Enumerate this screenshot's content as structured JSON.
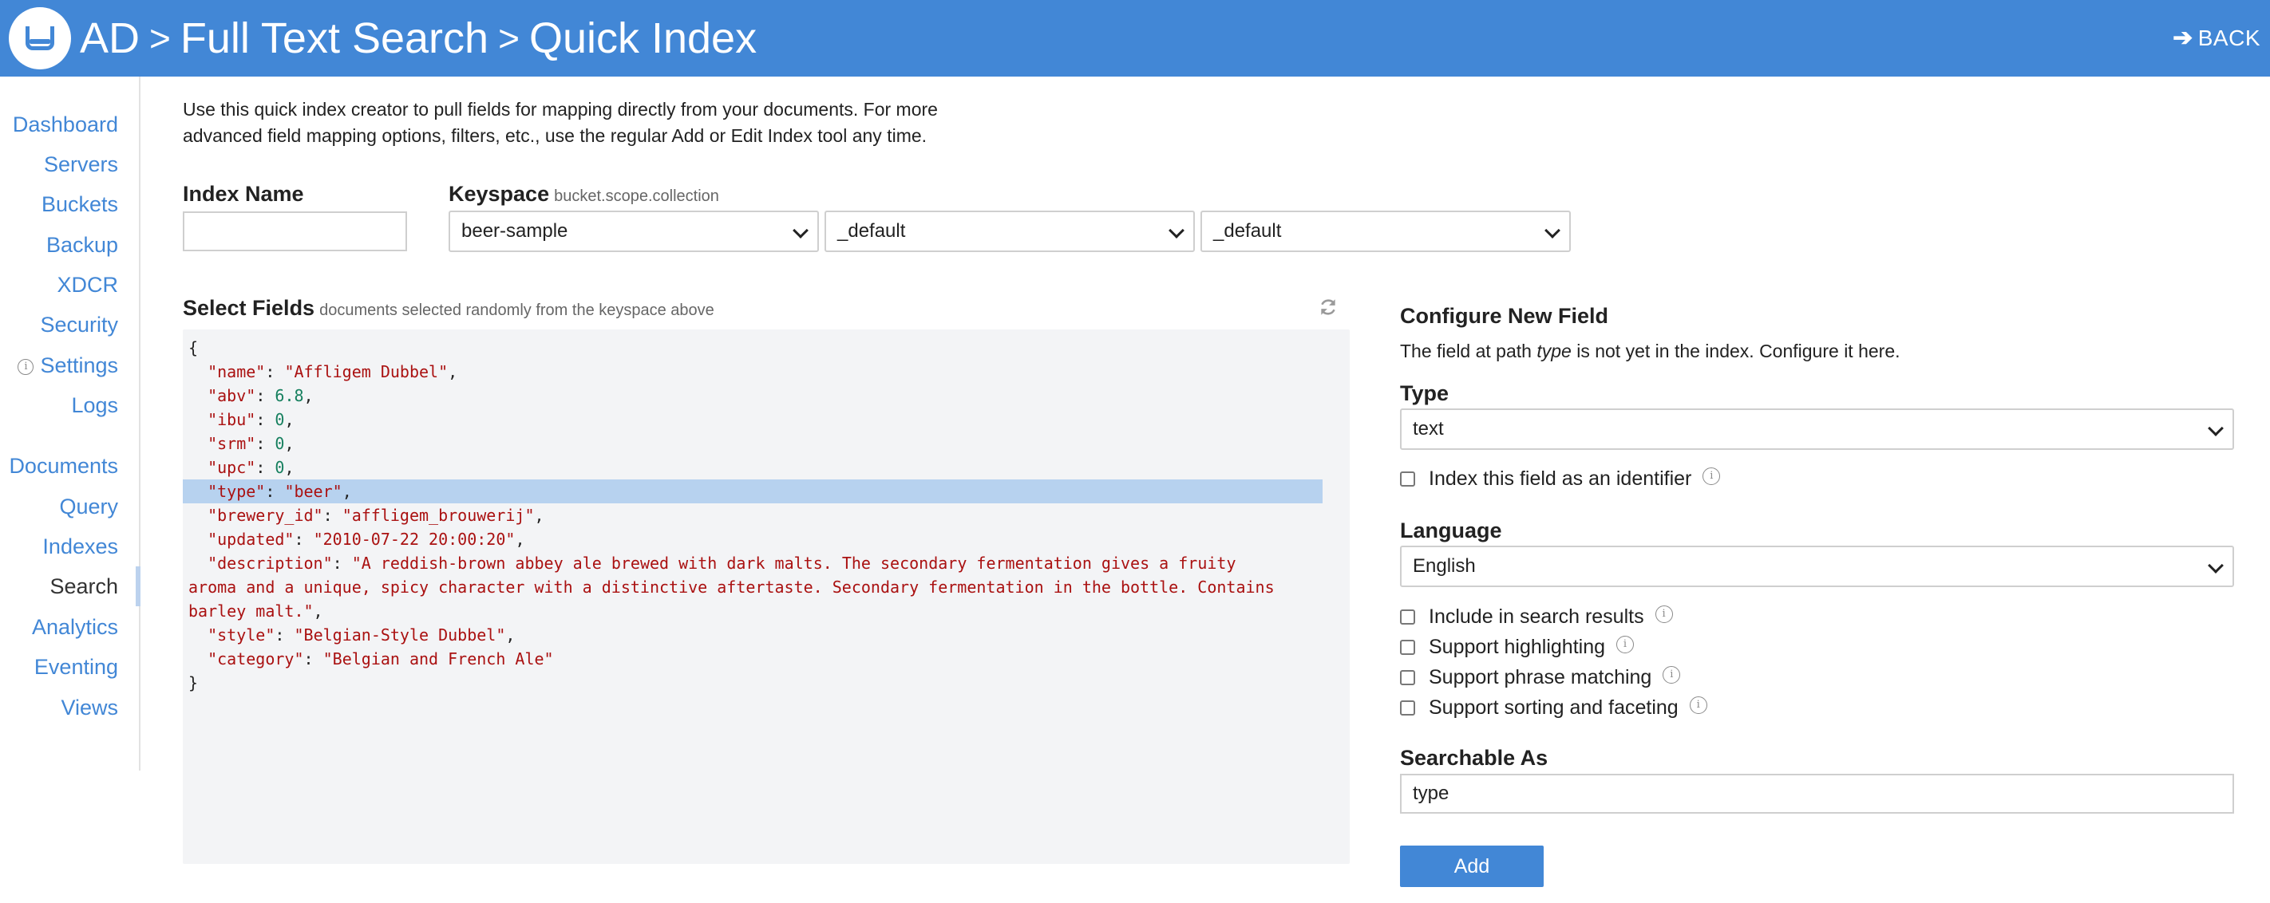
{
  "header": {
    "crumbs": [
      "AD",
      "Full Text Search",
      "Quick Index"
    ],
    "back_label": "BACK",
    "background_color": "#4287d6"
  },
  "sidebar": {
    "items": [
      {
        "label": "Dashboard",
        "active": false
      },
      {
        "label": "Servers",
        "active": false
      },
      {
        "label": "Buckets",
        "active": false
      },
      {
        "label": "Backup",
        "active": false
      },
      {
        "label": "XDCR",
        "active": false
      },
      {
        "label": "Security",
        "active": false
      },
      {
        "label": "Settings",
        "active": false,
        "info_icon": "i"
      },
      {
        "label": "Logs",
        "active": false
      },
      {
        "label": "Documents",
        "active": false
      },
      {
        "label": "Query",
        "active": false
      },
      {
        "label": "Indexes",
        "active": false
      },
      {
        "label": "Search",
        "active": true
      },
      {
        "label": "Analytics",
        "active": false
      },
      {
        "label": "Eventing",
        "active": false
      },
      {
        "label": "Views",
        "active": false
      }
    ]
  },
  "intro": "Use this quick index creator to pull fields for mapping directly from your documents. For more advanced field mapping options, filters, etc., use the regular Add or Edit Index tool any time.",
  "index_name": {
    "label": "Index Name",
    "value": ""
  },
  "keyspace": {
    "label": "Keyspace",
    "hint": "bucket.scope.collection",
    "bucket": "beer-sample",
    "scope": "_default",
    "collection": "_default"
  },
  "select_fields": {
    "label": "Select Fields",
    "hint": "documents selected randomly from the keyspace above",
    "open_brace": "{",
    "close_brace": "}",
    "lines": [
      {
        "key": "\"name\"",
        "value": "\"Affligem Dubbel\"",
        "type": "string"
      },
      {
        "key": "\"abv\"",
        "value": "6.8",
        "type": "number"
      },
      {
        "key": "\"ibu\"",
        "value": "0",
        "type": "number"
      },
      {
        "key": "\"srm\"",
        "value": "0",
        "type": "number"
      },
      {
        "key": "\"upc\"",
        "value": "0",
        "type": "number"
      },
      {
        "key": "\"type\"",
        "value": "\"beer\"",
        "type": "string",
        "selected": true
      },
      {
        "key": "\"brewery_id\"",
        "value": "\"affligem_brouwerij\"",
        "type": "string"
      },
      {
        "key": "\"updated\"",
        "value": "\"2010-07-22 20:00:20\"",
        "type": "string"
      },
      {
        "key": "\"description\"",
        "value_lines": [
          "\"A reddish-brown abbey ale brewed with dark malts. The secondary fermentation gives a fruity",
          "aroma and a unique, spicy character with a distinctive aftertaste. Secondary fermentation in the bottle. Contains",
          "barley malt.\""
        ],
        "type": "string"
      },
      {
        "key": "\"style\"",
        "value": "\"Belgian-Style Dubbel\"",
        "type": "string"
      },
      {
        "key": "\"category\"",
        "value": "\"Belgian and French Ale\"",
        "type": "string",
        "last": true
      }
    ]
  },
  "configure": {
    "title": "Configure New Field",
    "desc_before": "The field at path ",
    "desc_path": "type",
    "desc_after": " is not yet in the index. Configure it here.",
    "type_label": "Type",
    "type_value": "text",
    "identifier_label": "Index this field as an identifier",
    "language_label": "Language",
    "language_value": "English",
    "options": [
      "Include in search results",
      "Support highlighting",
      "Support phrase matching",
      "Support sorting and faceting"
    ],
    "searchable_label": "Searchable As",
    "searchable_value": "type",
    "add_label": "Add"
  }
}
